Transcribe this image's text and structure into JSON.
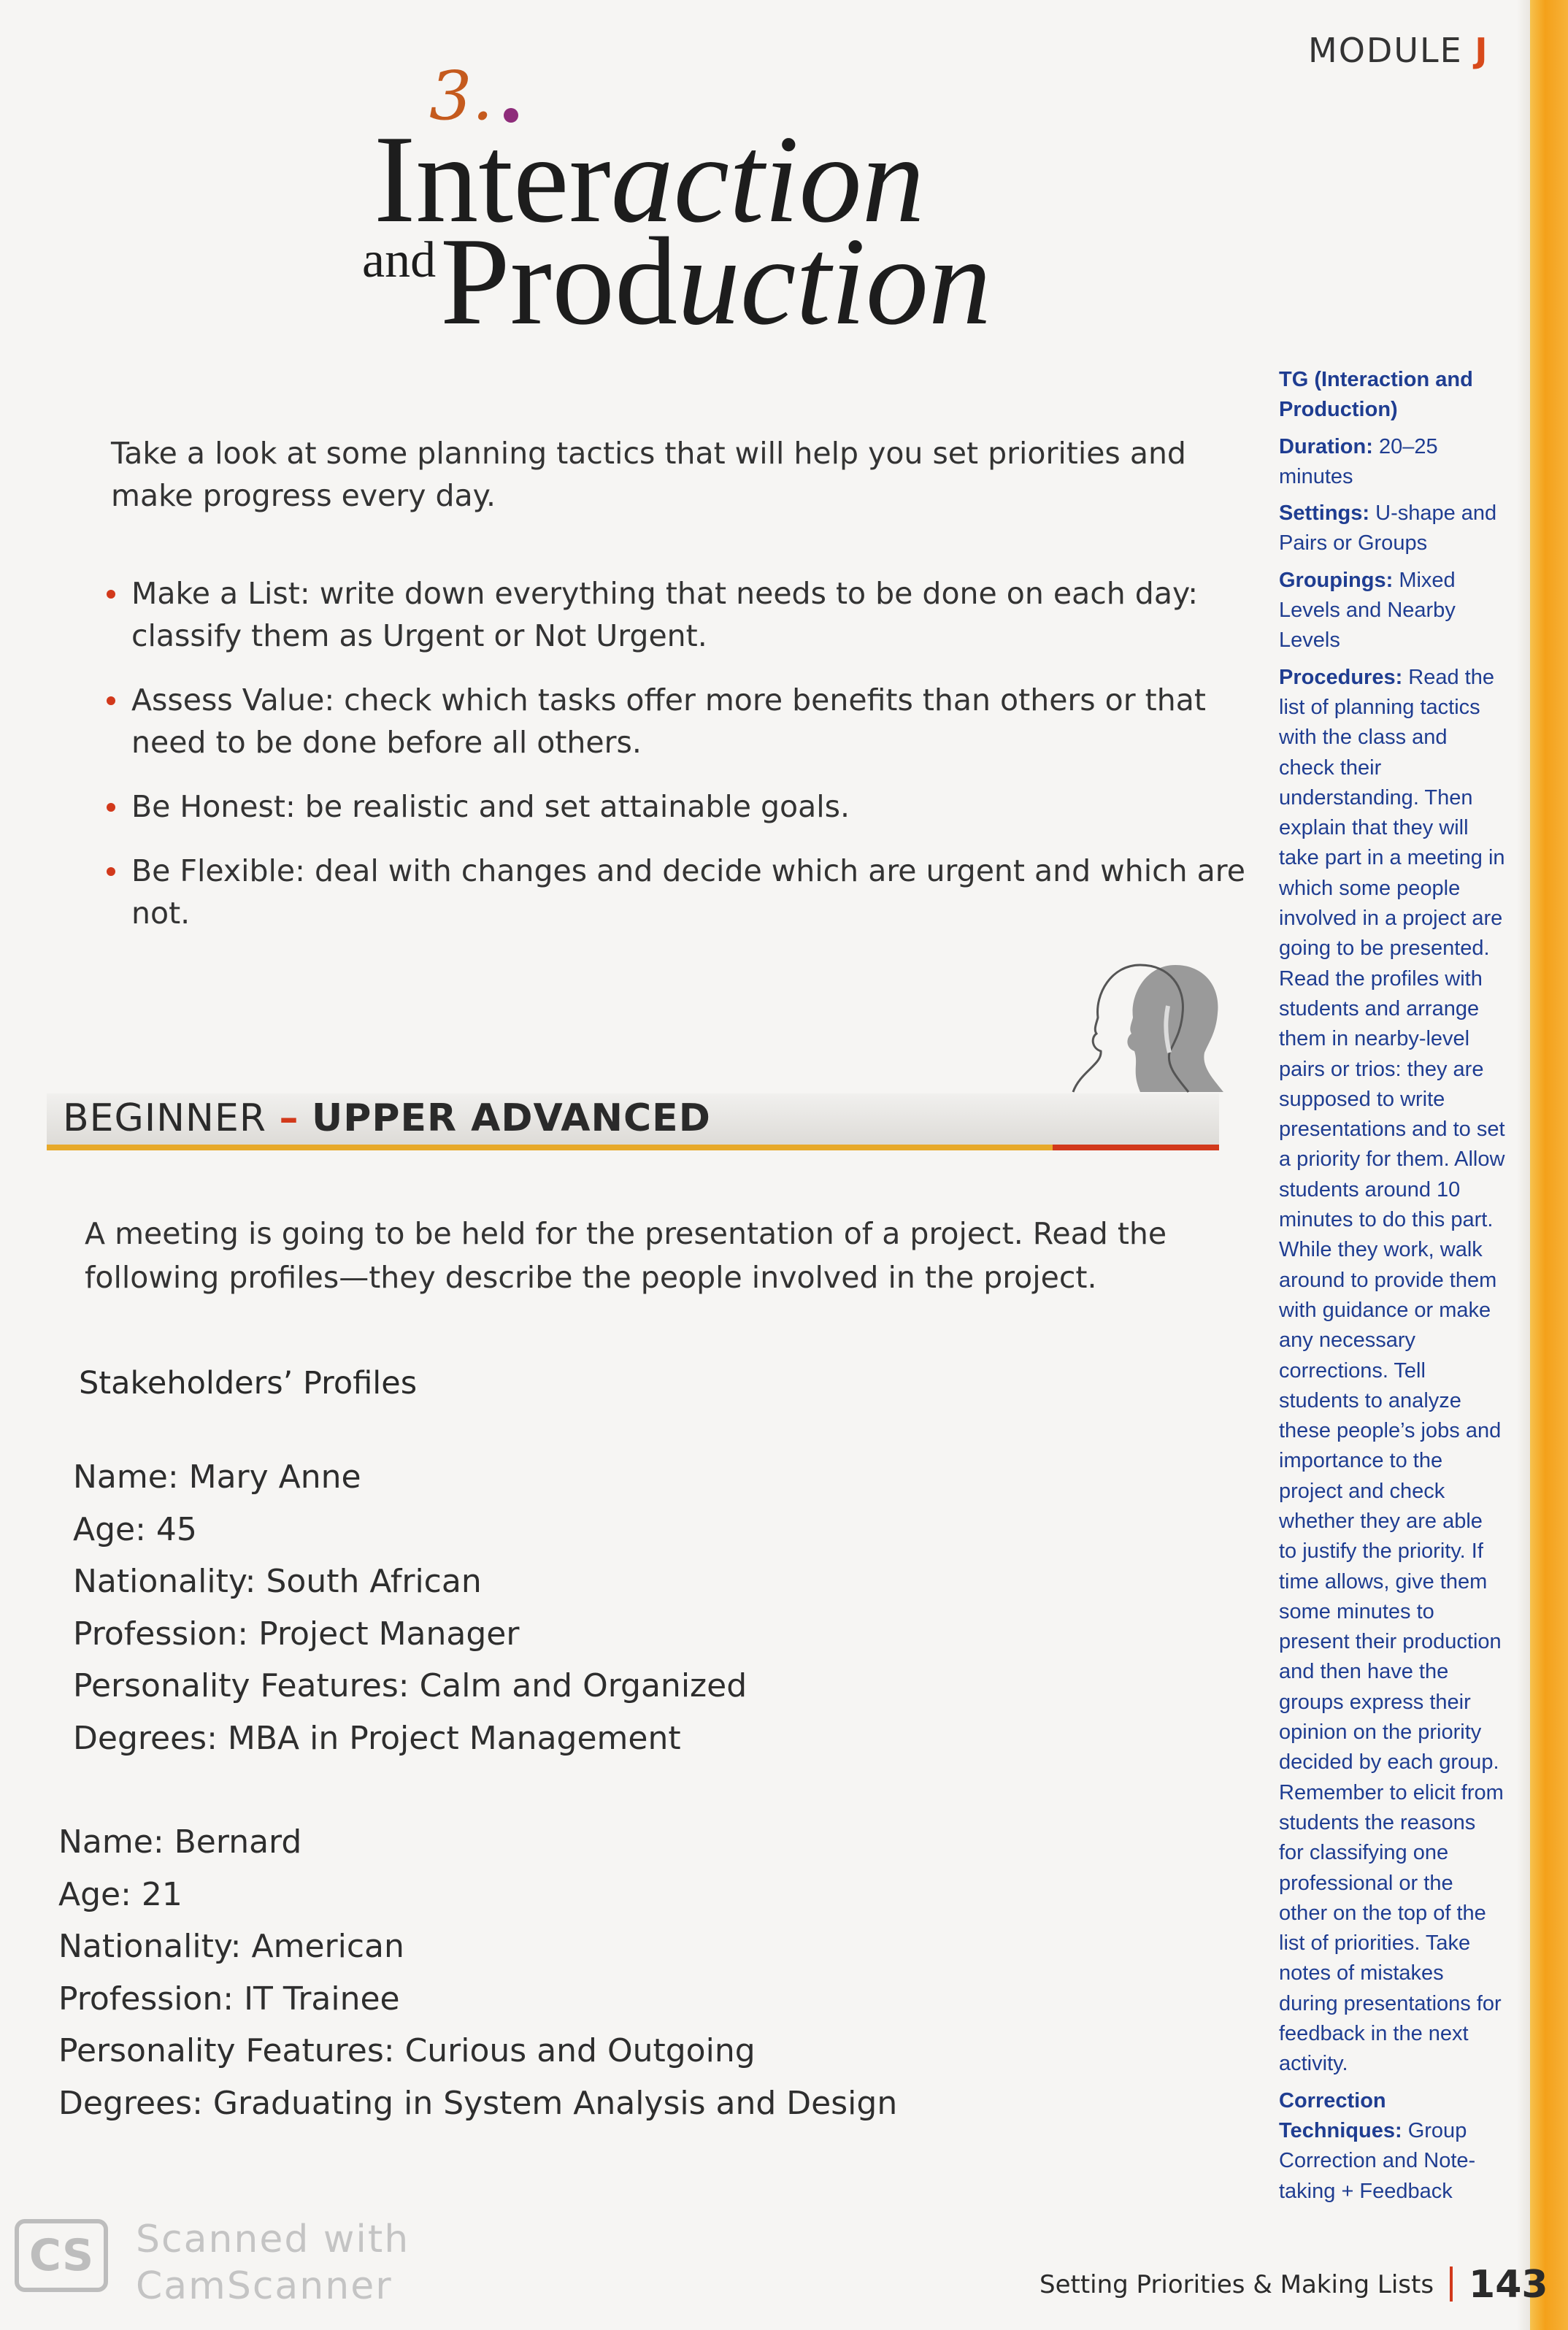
{
  "header": {
    "module_label": "MODULE",
    "module_letter": "J"
  },
  "title": {
    "number": "3.",
    "line1_plain": "Inter",
    "line1_italic": "action",
    "and": "and",
    "line2_plain": "Prod",
    "line2_italic": "uction"
  },
  "intro": "Take a look at some planning tactics that will help you set priorities and make progress every day.",
  "bullets": [
    "Make a List: write down everything that needs to be done on each day: classify them as Urgent or Not Urgent.",
    "Assess Value: check which tasks offer more benefits than others or that need to be done before all others.",
    "Be Honest: be realistic and set attainable goals.",
    "Be Flexible: deal with changes and decide which are urgent and which are not."
  ],
  "level_banner": {
    "start": "BEGINNER",
    "dash": "–",
    "end": "UPPER ADVANCED"
  },
  "meeting_text": "A meeting is going to be held for the presentation of a project. Read the following profiles—they describe the people involved in the project.",
  "stakeholders_heading": "Stakeholders’ Profiles",
  "profile_labels": {
    "name": "Name",
    "age": "Age",
    "nationality": "Nationality",
    "profession": "Profession",
    "personality": "Personality Features",
    "degrees": "Degrees"
  },
  "profiles": [
    {
      "name": "Mary Anne",
      "age": "45",
      "nationality": "South African",
      "profession": "Project Manager",
      "personality": "Calm and Organized",
      "degrees": "MBA in Project Management"
    },
    {
      "name": "Bernard",
      "age": "21",
      "nationality": "American",
      "profession": "IT Trainee",
      "personality": "Curious and Outgoing",
      "degrees": "Graduating in System Analysis and Design"
    }
  ],
  "sidebar": {
    "tg_title": "TG (Interaction and Production)",
    "duration_label": "Duration:",
    "duration": "20–25 minutes",
    "settings_label": "Settings:",
    "settings": "U-shape and Pairs or Groups",
    "groupings_label": "Groupings:",
    "groupings": "Mixed Levels and Nearby Levels",
    "procedures_label": "Procedures:",
    "procedures": "Read the list of planning tactics with the class and check their understanding. Then explain that they will take part in a meeting in which some people involved in a project are going to be presented. Read the profiles with students and arrange them in nearby-level pairs or trios: they are supposed to write presentations and to set a priority for them. Allow students around 10 minutes to do this part. While they work, walk around to provide them with guidance or make any necessary corrections. Tell students to analyze these people’s jobs and importance to the project and check whether they are able to justify the priority. If time allows, give them some minutes to present their production and then have the groups express their opinion on the priority decided by each group. Remember to elicit from students the reasons for classifying one professional or the other on the top of the list of priorities. Take notes of mistakes during presentations for feedback in the next activity.",
    "correction_label": "Correction Techniques:",
    "correction": "Group Correction and Note-taking + Feedback"
  },
  "footer": {
    "text": "Setting Priorities & Making Lists",
    "page": "143"
  },
  "watermark": {
    "logo": "CS",
    "line1": "Scanned with",
    "line2": "CamScanner"
  },
  "colors": {
    "accent_red": "#d2391b",
    "strip_orange": "#f4a11a",
    "sidebar_blue": "#1f3d91"
  }
}
